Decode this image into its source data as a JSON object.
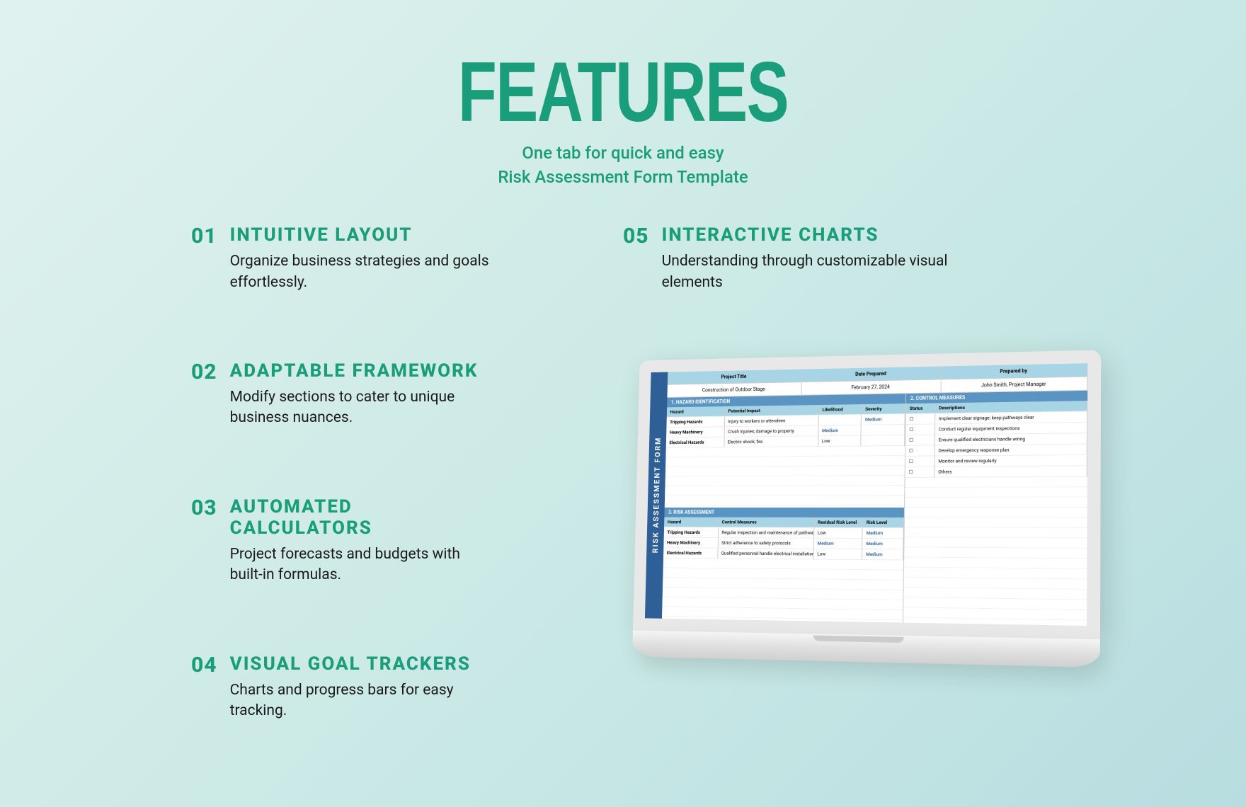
{
  "hero": {
    "title": "FEATURES",
    "subtitle_line1": "One tab for quick and easy",
    "subtitle_line2": "Risk Assessment Form Template"
  },
  "features": [
    {
      "num": "01",
      "title": "INTUITIVE LAYOUT",
      "desc": "Organize business strategies and goals effortlessly."
    },
    {
      "num": "02",
      "title": "ADAPTABLE FRAMEWORK",
      "desc": "Modify sections to cater to unique business nuances."
    },
    {
      "num": "03",
      "title": "AUTOMATED CALCULATORS",
      "desc": "Project forecasts and budgets with built-in formulas."
    },
    {
      "num": "04",
      "title": "VISUAL GOAL TRACKERS",
      "desc": "Charts and progress bars for easy tracking."
    },
    {
      "num": "05",
      "title": "INTERACTIVE CHARTS",
      "desc": "Understanding through customizable visual elements"
    }
  ],
  "mockup": {
    "side_label": "RISK ASSESSMENT FORM",
    "headers": [
      {
        "label": "Project Title",
        "value": "Construction of Outdoor Stage"
      },
      {
        "label": "Date Prepared",
        "value": "February 27, 2024"
      },
      {
        "label": "Prepared by",
        "value": "John Smith, Project Manager"
      }
    ],
    "section1": {
      "title": "1. HAZARD IDENTIFICATION",
      "columns": [
        "Hazard",
        "Potential Impact",
        "Likelihood",
        "Severity"
      ],
      "rows": [
        [
          "Tripping Hazards",
          "Injury to workers or attendees",
          "",
          "Medium"
        ],
        [
          "Heavy Machinery",
          "Crush injuries; damage to property",
          "Medium",
          ""
        ],
        [
          "Electrical Hazards",
          "Electric shock; fire",
          "Low",
          ""
        ]
      ]
    },
    "section2": {
      "title": "2. CONTROL MEASURES",
      "columns": [
        "Status",
        "Descriptions"
      ],
      "rows": [
        [
          "☐",
          "Implement clear signage; keep pathways clear"
        ],
        [
          "☐",
          "Conduct regular equipment inspections"
        ],
        [
          "☐",
          "Ensure qualified electricians handle wiring"
        ],
        [
          "☐",
          "Develop emergency response plan"
        ],
        [
          "☐",
          "Monitor and review regularly"
        ],
        [
          "☐",
          "Others"
        ]
      ]
    },
    "section3": {
      "title": "3. RISK ASSESSMENT",
      "columns": [
        "Hazard",
        "Control Measures",
        "Residual Risk Level",
        "Risk Level"
      ],
      "rows": [
        [
          "Tripping Hazards",
          "Regular inspection and maintenance of pathways",
          "Low",
          "Medium"
        ],
        [
          "Heavy Machinery",
          "Strict adherence to safety protocols",
          "Medium",
          "Medium"
        ],
        [
          "Electrical Hazards",
          "Qualified personnel handle electrical installations",
          "Low",
          "Medium"
        ]
      ]
    }
  }
}
